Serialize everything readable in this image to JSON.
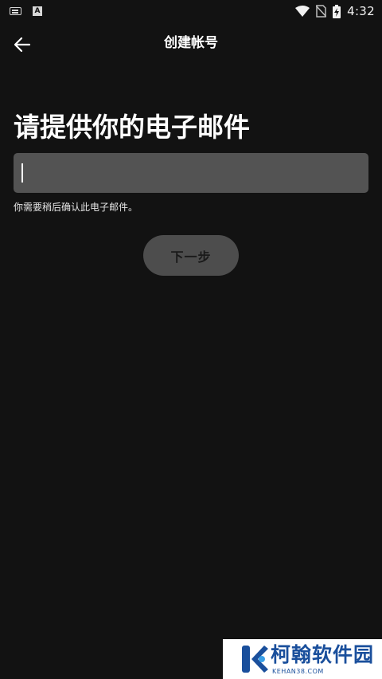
{
  "status_bar": {
    "time": "4:32",
    "icons": [
      "keyboard-icon",
      "a-letter-icon",
      "wifi-icon",
      "no-sim-icon",
      "battery-charging-icon"
    ]
  },
  "app_bar": {
    "back_icon": "arrow-left-icon",
    "title": "创建帐号"
  },
  "form": {
    "heading": "请提供你的电子邮件",
    "email_value": "",
    "hint": "你需要稍后确认此电子邮件。",
    "next_label": "下一步"
  },
  "watermark": {
    "name": "柯翰软件园",
    "url": "KEHAN38.COM"
  },
  "colors": {
    "background": "#121212",
    "input_bg": "#535353",
    "button_bg": "#4d4d4d",
    "watermark_blue": "#1a4f9c"
  }
}
